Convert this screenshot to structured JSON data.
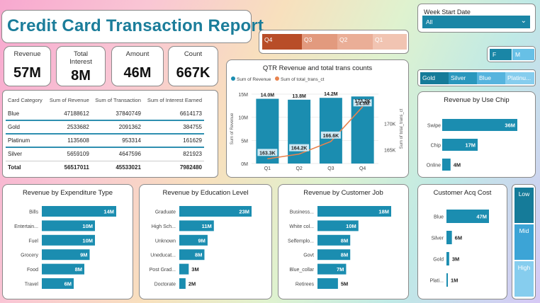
{
  "report": {
    "title": "Credit Card Transaction Report"
  },
  "kpis": [
    {
      "label": "Revenue",
      "value": "57M"
    },
    {
      "label": "Total Interest",
      "value": "8M"
    },
    {
      "label": "Amount",
      "value": "46M"
    },
    {
      "label": "Count",
      "value": "667K"
    }
  ],
  "quarter_slicer": [
    "Q4",
    "Q3",
    "Q2",
    "Q1"
  ],
  "week_filter": {
    "label": "Week Start Date",
    "value": "All"
  },
  "gender_slicer": [
    "F",
    "M"
  ],
  "category_slicer": [
    "Gold",
    "Silver",
    "Blue",
    "Platinu..."
  ],
  "income_slicer": [
    "Low",
    "Mid",
    "High"
  ],
  "table": {
    "headers": [
      "Card Category",
      "Sum of Revenue",
      "Sum of Transaction",
      "Sum of Interest Earned"
    ],
    "rows": [
      [
        "Blue",
        "47188612",
        "37840749",
        "6614173"
      ],
      [
        "Gold",
        "2533682",
        "2091362",
        "384755"
      ],
      [
        "Platinum",
        "1135608",
        "953314",
        "161629"
      ],
      [
        "Silver",
        "5659109",
        "4647596",
        "821923"
      ]
    ],
    "total": [
      "Total",
      "56517011",
      "45533021",
      "7982480"
    ]
  },
  "colors": {
    "bar": "#1b8db0",
    "line": "#e8834e",
    "title": "#1b7d9a"
  },
  "chart_data": [
    {
      "id": "qtr",
      "type": "bar",
      "title": "QTR Revenue and total trans counts",
      "legend": [
        "Sum of Revenue",
        "Sum of total_trans_ct"
      ],
      "ylabel": "Sum of Revenue",
      "y2label": "Sum of total_trans_ct",
      "categories": [
        "Q1",
        "Q2",
        "Q3",
        "Q4"
      ],
      "series": [
        {
          "name": "Sum of Revenue",
          "values": [
            14.0,
            13.8,
            14.2,
            14.5
          ],
          "labels": [
            "14.0M",
            "13.8M",
            "14.2M",
            "14.5M"
          ]
        },
        {
          "name": "Sum of total_trans_ct",
          "values": [
            163.3,
            164.2,
            166.6,
            173.2
          ],
          "labels": [
            "163.3K",
            "164.2K",
            "166.6K",
            "173.2K"
          ]
        }
      ],
      "yticks": [
        "0M",
        "5M",
        "10M",
        "15M"
      ],
      "ylim": [
        0,
        15
      ],
      "y2ticks": [
        "165K",
        "170K"
      ],
      "y2lim": [
        162.4,
        175.6
      ]
    },
    {
      "id": "chip",
      "type": "bar",
      "title": "Revenue by Use Chip",
      "categories": [
        "Swipe",
        "Chip",
        "Online"
      ],
      "values": [
        36,
        17,
        4
      ],
      "labels": [
        "36M",
        "17M",
        "4M"
      ]
    },
    {
      "id": "exp",
      "type": "bar",
      "title": "Revenue by Expenditure Type",
      "categories": [
        "Bills",
        "Entertain...",
        "Fuel",
        "Grocery",
        "Food",
        "Travel"
      ],
      "values": [
        14,
        10,
        10,
        9,
        8,
        6
      ],
      "labels": [
        "14M",
        "10M",
        "10M",
        "9M",
        "8M",
        "6M"
      ]
    },
    {
      "id": "edu",
      "type": "bar",
      "title": "Revenue by Education Level",
      "categories": [
        "Graduate",
        "High Sch...",
        "Unknown",
        "Uneducat...",
        "Post Grad...",
        "Doctorate"
      ],
      "values": [
        23,
        11,
        9,
        8,
        3,
        2
      ],
      "labels": [
        "23M",
        "11M",
        "9M",
        "8M",
        "3M",
        "2M"
      ]
    },
    {
      "id": "job",
      "type": "bar",
      "title": "Revenue by Customer Job",
      "categories": [
        "Business...",
        "White col...",
        "Selfemplo...",
        "Govt",
        "Blue_collar",
        "Retirees"
      ],
      "values": [
        18,
        10,
        8,
        8,
        7,
        5
      ],
      "labels": [
        "18M",
        "10M",
        "8M",
        "8M",
        "7M",
        "5M"
      ]
    },
    {
      "id": "acq",
      "type": "bar",
      "title": "Customer Acq Cost",
      "categories": [
        "Blue",
        "Silver",
        "Gold",
        "Plati..."
      ],
      "values": [
        47,
        6,
        3,
        1
      ],
      "labels": [
        "47M",
        "6M",
        "3M",
        "1M"
      ]
    }
  ]
}
